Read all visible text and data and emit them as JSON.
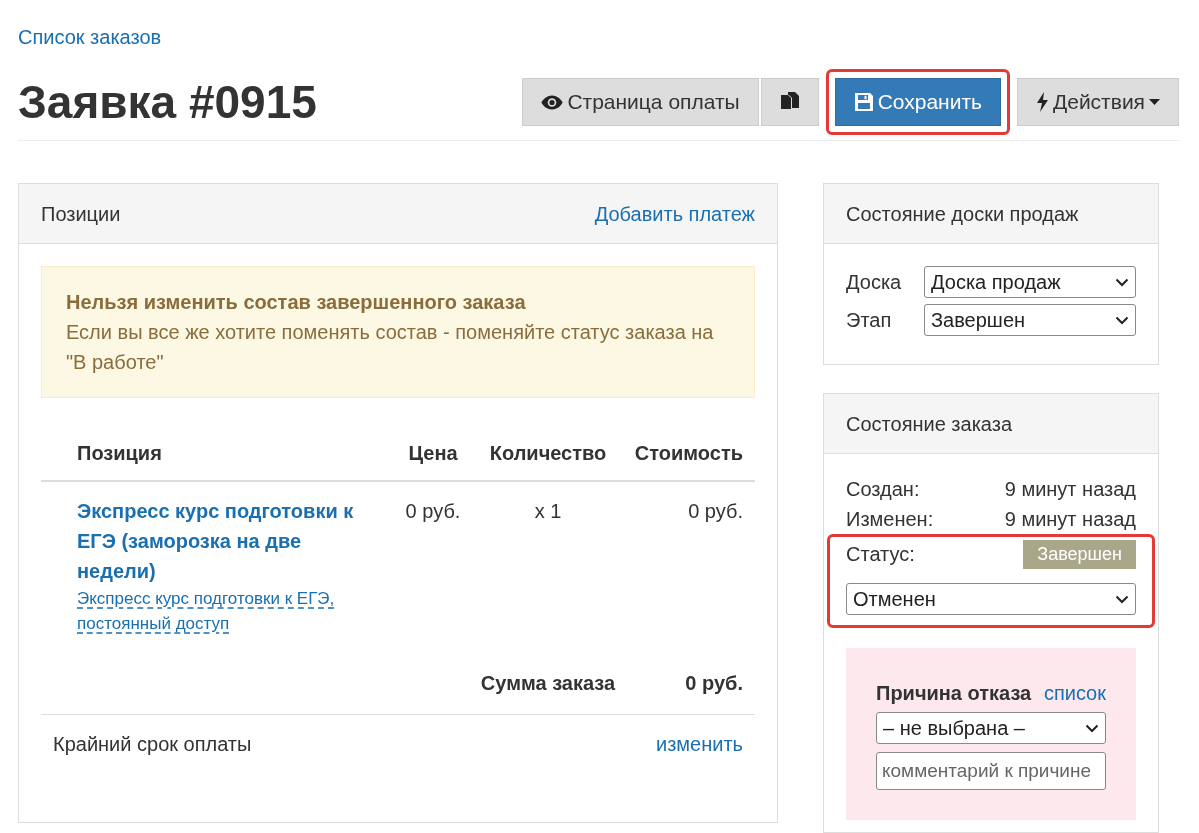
{
  "breadcrumb": {
    "label": "Список заказов"
  },
  "title": "Заявка #0915",
  "toolbar": [
    {
      "kind": "view",
      "label": "Страница оплаты",
      "primary": false,
      "highlighted": false
    },
    {
      "kind": "copy",
      "primary": false,
      "highlighted": false
    },
    {
      "kind": "save",
      "label": "Сохранить",
      "primary": true,
      "highlighted": true
    },
    {
      "kind": "menu",
      "label": "Действия",
      "primary": false,
      "highlighted": false
    }
  ],
  "positions_panel": {
    "title": "Позиции",
    "action": "Добавить платеж",
    "alert": {
      "title": "Нельзя изменить состав завершенного заказа",
      "text": "Если вы все же хотите поменять состав - поменяйте статус заказа на \"В работе\""
    },
    "columns": [
      "Позиция",
      "Цена",
      "Количество",
      "Стоимость"
    ],
    "rows": [
      {
        "name": "Экспресс курс подготовки к ЕГЭ (заморозка на две недели)",
        "offer": "Экспресс курс подготовки к ЕГЭ, постоянный доступ",
        "price": "0 руб.",
        "quantity": "x 1",
        "cost": "0 руб."
      }
    ],
    "total_label": "Сумма заказа",
    "total": "0 руб.",
    "deadline_label": "Крайний срок оплаты",
    "deadline_action": "изменить"
  },
  "board_panel": {
    "title": "Состояние доски продаж",
    "fields": [
      {
        "label": "Доска",
        "value": "Доска продаж"
      },
      {
        "label": "Этап",
        "value": "Завершен"
      }
    ]
  },
  "order_panel": {
    "title": "Состояние заказа",
    "info": [
      {
        "label": "Создан:",
        "value": "9 минут назад"
      },
      {
        "label": "Изменен:",
        "value": "9 минут назад"
      }
    ],
    "status_label": "Статус:",
    "status_badge": "Завершен",
    "status_value": "Отменен",
    "highlighted": true,
    "reason": {
      "title": "Причина отказа",
      "link": "список",
      "value": "– не выбрана –",
      "placeholder": "комментарий к причине"
    }
  }
}
